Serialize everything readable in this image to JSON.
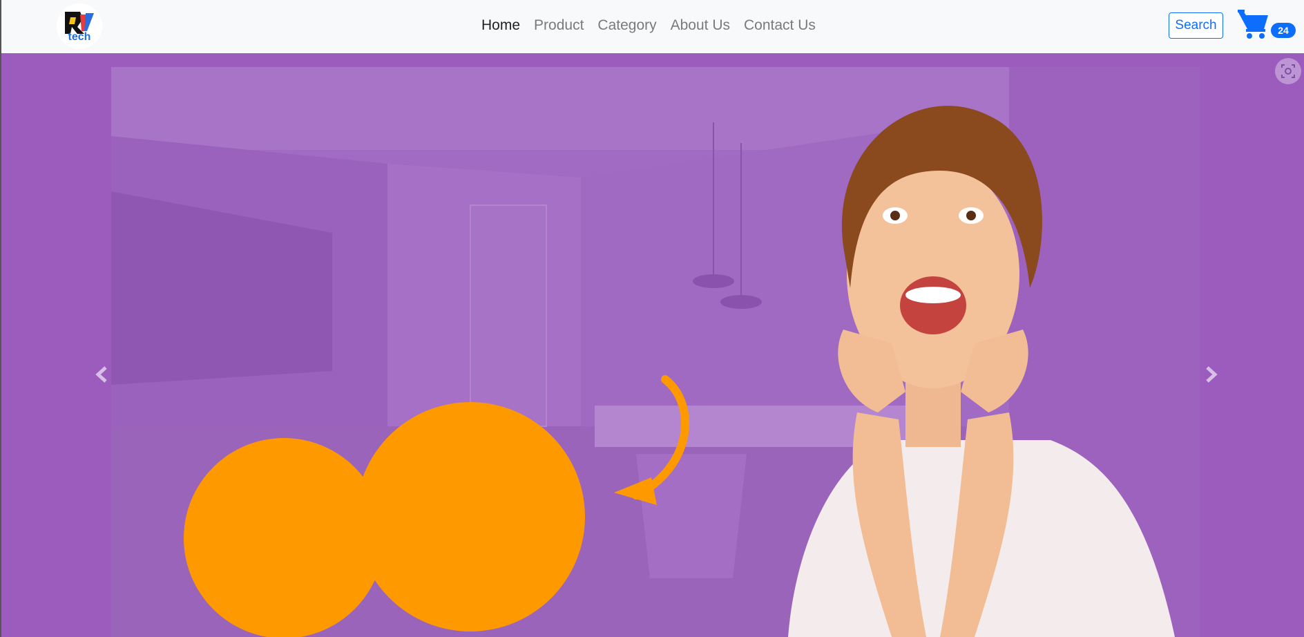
{
  "brand": {
    "logo_text": "RV",
    "logo_subtext": "tech",
    "icon": "brand-logo"
  },
  "nav": {
    "items": [
      {
        "label": "Home",
        "active": true
      },
      {
        "label": "Product",
        "active": false
      },
      {
        "label": "Category",
        "active": false
      },
      {
        "label": "About Us",
        "active": false
      },
      {
        "label": "Contact Us",
        "active": false
      }
    ]
  },
  "search": {
    "label": "Search"
  },
  "cart": {
    "icon": "cart-icon",
    "count": "24"
  },
  "carousel": {
    "prev_icon": "chevron-left-icon",
    "next_icon": "chevron-right-icon",
    "background_color": "#9b5cbd",
    "accent_color": "#ff9900"
  },
  "screen_capture": {
    "icon": "screen-capture-icon"
  },
  "colors": {
    "primary": "#0d6efd",
    "navbar_bg": "#f8f9fa",
    "hero_bg": "#9b5cbd",
    "orange": "#ff9900"
  }
}
